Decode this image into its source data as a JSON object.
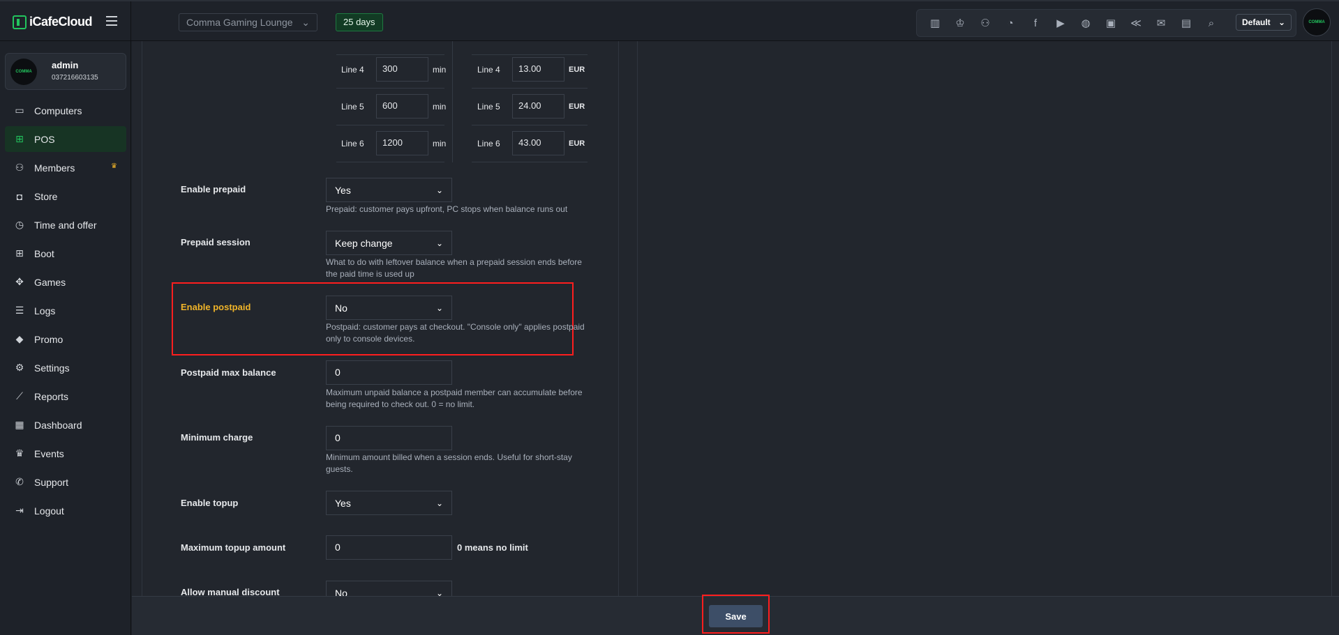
{
  "app": {
    "name": "iCafeCloud"
  },
  "header": {
    "location": "Comma Gaming Lounge",
    "days_badge": "25 days",
    "profile_select": "Default",
    "tray_icons": [
      "dashboard-icon",
      "trophy-icon",
      "users-icon",
      "rss-icon",
      "facebook-icon",
      "youtube-icon",
      "globe-icon",
      "icafe-icon",
      "ggcircuit-icon",
      "mail-icon",
      "chat-icon",
      "search-icon"
    ]
  },
  "user": {
    "name": "admin",
    "phone": "037216603135",
    "avatar_text": "COMMA"
  },
  "sidebar": {
    "items": [
      {
        "label": "Computers",
        "icon": "monitor-icon",
        "glyph": "▭"
      },
      {
        "label": "POS",
        "icon": "register-icon",
        "glyph": "⊞",
        "active": true
      },
      {
        "label": "Members",
        "icon": "members-icon",
        "glyph": "⚇"
      },
      {
        "label": "Store",
        "icon": "bag-icon",
        "glyph": "◘"
      },
      {
        "label": "Time and offer",
        "icon": "stopwatch-icon",
        "glyph": "◷"
      },
      {
        "label": "Boot",
        "icon": "windows-icon",
        "glyph": "⊞"
      },
      {
        "label": "Games",
        "icon": "gamepad-icon",
        "glyph": "✥"
      },
      {
        "label": "Logs",
        "icon": "list-icon",
        "glyph": "☰"
      },
      {
        "label": "Promo",
        "icon": "tag-icon",
        "glyph": "◆"
      },
      {
        "label": "Settings",
        "icon": "gear-icon",
        "glyph": "⚙"
      },
      {
        "label": "Reports",
        "icon": "chart-line-icon",
        "glyph": "⟋"
      },
      {
        "label": "Dashboard",
        "icon": "grid-icon",
        "glyph": "▦"
      },
      {
        "label": "Events",
        "icon": "crown-icon",
        "glyph": "♛"
      },
      {
        "label": "Support",
        "icon": "phone-icon",
        "glyph": "✆"
      },
      {
        "label": "Logout",
        "icon": "logout-icon",
        "glyph": "⇥"
      }
    ]
  },
  "lines": {
    "time": [
      {
        "label": "Line 4",
        "value": "300",
        "unit": "min"
      },
      {
        "label": "Line 5",
        "value": "600",
        "unit": "min"
      },
      {
        "label": "Line 6",
        "value": "1200",
        "unit": "min"
      }
    ],
    "price": [
      {
        "label": "Line 4",
        "value": "13.00",
        "unit": "EUR"
      },
      {
        "label": "Line 5",
        "value": "24.00",
        "unit": "EUR"
      },
      {
        "label": "Line 6",
        "value": "43.00",
        "unit": "EUR"
      }
    ]
  },
  "fields": {
    "enable_prepaid": {
      "label": "Enable prepaid",
      "value": "Yes",
      "help": "Prepaid: customer pays upfront, PC stops when balance runs out"
    },
    "prepaid_session": {
      "label": "Prepaid session",
      "value": "Keep change",
      "help": "What to do with leftover balance when a prepaid session ends before the paid time is used up"
    },
    "enable_postpaid": {
      "label": "Enable postpaid",
      "value": "No",
      "help": "Postpaid: customer pays at checkout. \"Console only\" applies postpaid only to console devices."
    },
    "postpaid_max_balance": {
      "label": "Postpaid max balance",
      "value": "0",
      "help": "Maximum unpaid balance a postpaid member can accumulate before being required to check out. 0 = no limit."
    },
    "minimum_charge": {
      "label": "Minimum charge",
      "value": "0",
      "help": "Minimum amount billed when a session ends. Useful for short-stay guests."
    },
    "enable_topup": {
      "label": "Enable topup",
      "value": "Yes"
    },
    "maximum_topup_amount": {
      "label": "Maximum topup amount",
      "value": "0",
      "note": "0 means no limit"
    },
    "allow_manual_discount": {
      "label": "Allow manual discount",
      "value": "No"
    }
  },
  "footer": {
    "save_label": "Save"
  },
  "colors": {
    "accent": "#22c55e",
    "warning": "#f0b429",
    "highlight": "#ff1e1e"
  }
}
